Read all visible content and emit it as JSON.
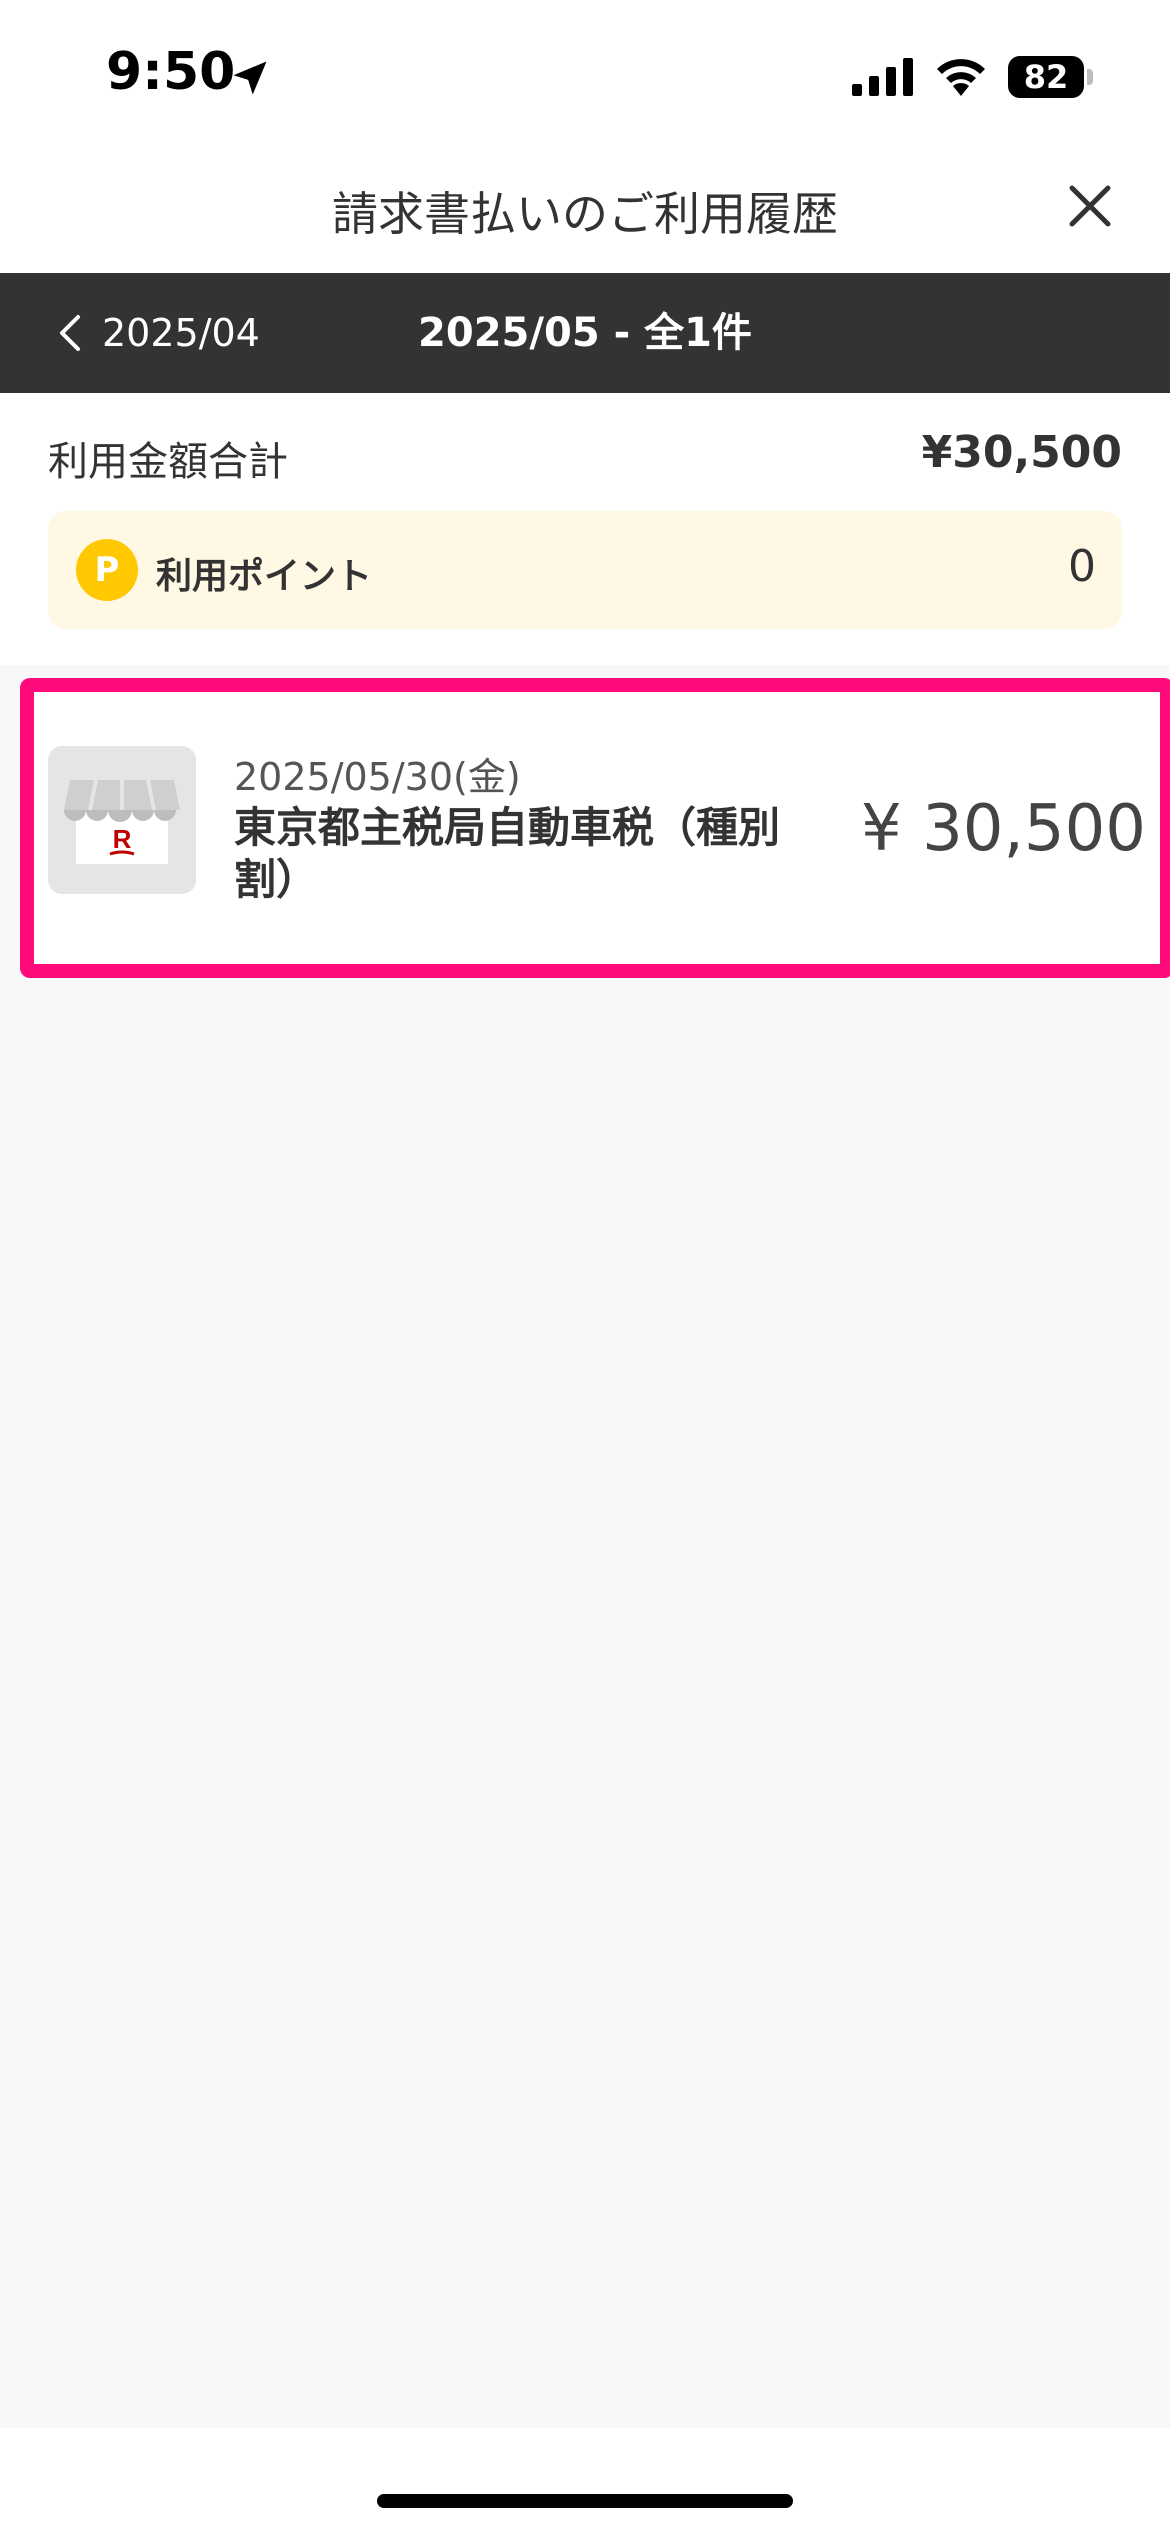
{
  "status_bar": {
    "time": "9:50",
    "battery_level": "82",
    "icons": [
      "location-arrow-icon",
      "signal-icon",
      "wifi-icon",
      "battery-icon"
    ]
  },
  "header": {
    "title": "請求書払いのご利用履歴",
    "close_icon": "close-icon"
  },
  "month_nav": {
    "prev_label": "2025/04",
    "current_label": "2025/05 - 全1件"
  },
  "summary": {
    "total_label": "利用金額合計",
    "total_value": "¥30,500",
    "points_badge": "P",
    "points_label": "利用ポイント",
    "points_value": "0"
  },
  "transactions": [
    {
      "date": "2025/05/30(金)",
      "merchant": "東京都主税局自動車税（種別割）",
      "amount": "¥ 30,500",
      "thumbnail_icon": "rakuten-shop-icon"
    }
  ],
  "colors": {
    "nav_background": "#333333",
    "highlight_border": "#ff0a7b",
    "point_badge": "#ffc800",
    "points_box_background": "#fff8e5",
    "list_background": "#f8f8f8"
  }
}
